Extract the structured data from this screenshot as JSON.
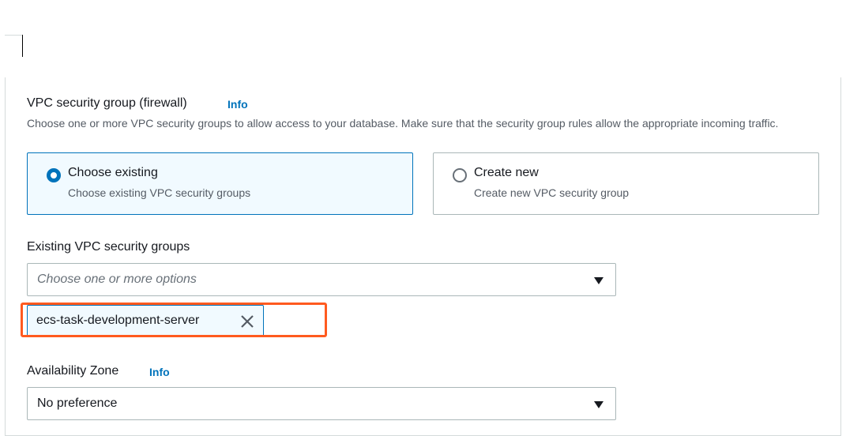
{
  "security_group": {
    "title": "VPC security group (firewall)",
    "info": "Info",
    "description": "Choose one or more VPC security groups to allow access to your database. Make sure that the security group rules allow the appropriate incoming traffic.",
    "options": [
      {
        "title": "Choose existing",
        "subtitle": "Choose existing VPC security groups",
        "selected": true
      },
      {
        "title": "Create new",
        "subtitle": "Create new VPC security group",
        "selected": false
      }
    ]
  },
  "existing_groups": {
    "label": "Existing VPC security groups",
    "placeholder": "Choose one or more options",
    "tokens": [
      "ecs-task-development-server"
    ]
  },
  "availability_zone": {
    "label": "Availability Zone",
    "info": "Info",
    "value": "No preference"
  },
  "icons": {
    "dropdown": "caret-down-icon",
    "remove": "close-icon"
  },
  "colors": {
    "link": "#0073bb",
    "selected_border": "#0073bb",
    "highlight": "#ff5a1f"
  }
}
